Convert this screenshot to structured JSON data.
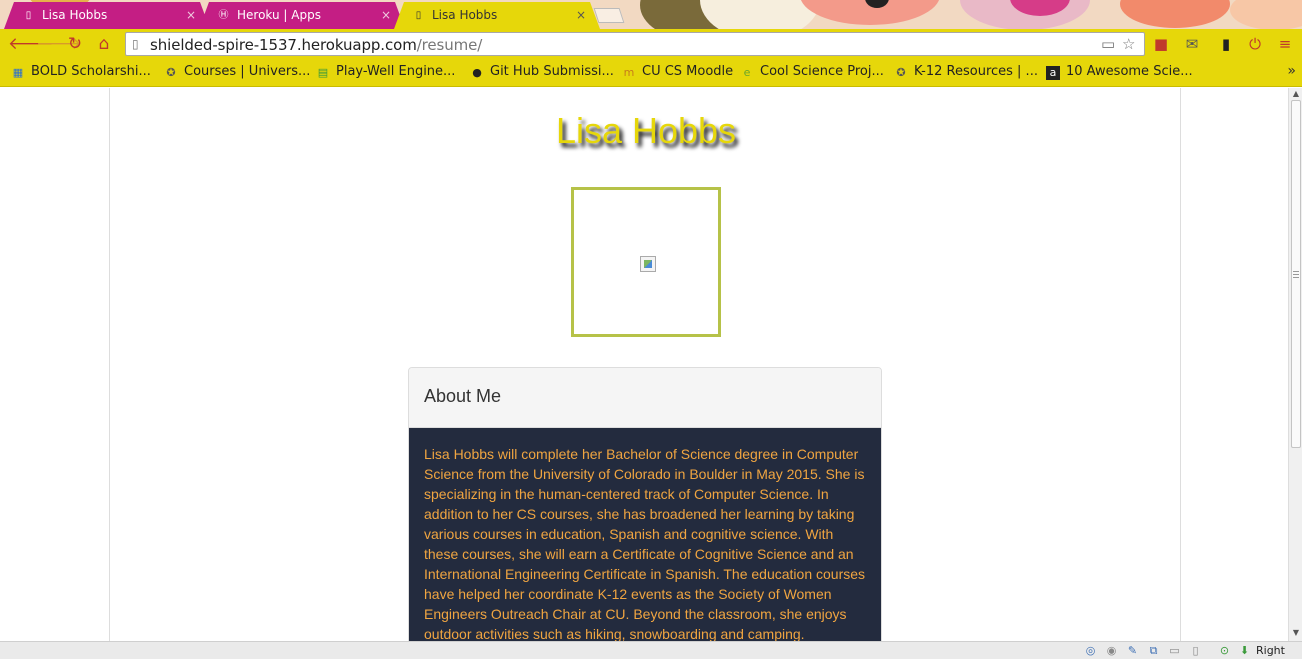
{
  "browser": {
    "tabs": [
      {
        "label": "Lisa Hobbs",
        "icon": "page-icon",
        "active": false
      },
      {
        "label": "Heroku | Apps",
        "icon": "heroku-icon",
        "active": false
      },
      {
        "label": "Lisa Hobbs",
        "icon": "page-icon",
        "active": true
      }
    ],
    "tab_close": "×",
    "url": {
      "host": "shielded-spire-1537.herokuapp.com",
      "path": "/resume/"
    },
    "theme_colors": {
      "toolbar": "#e6d70a",
      "inactive_tab": "#c41e84"
    }
  },
  "bookmarks": [
    {
      "label": "BOLD Scholarshi...",
      "icon": "calendar-icon"
    },
    {
      "label": "Courses | Univers...",
      "icon": "cu-logo-icon"
    },
    {
      "label": "Play-Well Engine...",
      "icon": "doc-icon"
    },
    {
      "label": "Git Hub Submissi...",
      "icon": "github-icon"
    },
    {
      "label": "CU CS Moodle",
      "icon": "moodle-icon"
    },
    {
      "label": "Cool Science Proj...",
      "icon": "e-icon"
    },
    {
      "label": "K-12 Resources | ...",
      "icon": "cu-logo-icon"
    },
    {
      "label": "10 Awesome Scie...",
      "icon": "amazon-icon"
    }
  ],
  "bookmarks_overflow": "»",
  "page": {
    "name": "Lisa Hobbs",
    "about": {
      "heading": "About Me",
      "body": "Lisa Hobbs will complete her Bachelor of Science degree in Computer Science from the University of Colorado in Boulder in May 2015. She is specializing in the human-centered track of Computer Science. In addition to her CS courses, she has broadened her learning by taking various courses in education, Spanish and cognitive science. With these courses, she will earn a Certificate of Cognitive Science and an International Engineering Certificate in Spanish. The education courses have helped her coordinate K-12 events as the Society of Women Engineers Outreach Chair at CU. Beyond the classroom, she enjoys outdoor activities such as hiking, snowboarding and camping."
    },
    "colors": {
      "name_text": "#e6d70a",
      "photo_border": "#b6c248",
      "panel_body_bg": "#232b3e",
      "panel_body_text": "#f0a541"
    }
  },
  "taskbar": {
    "right_label": "Right Ctrl"
  }
}
